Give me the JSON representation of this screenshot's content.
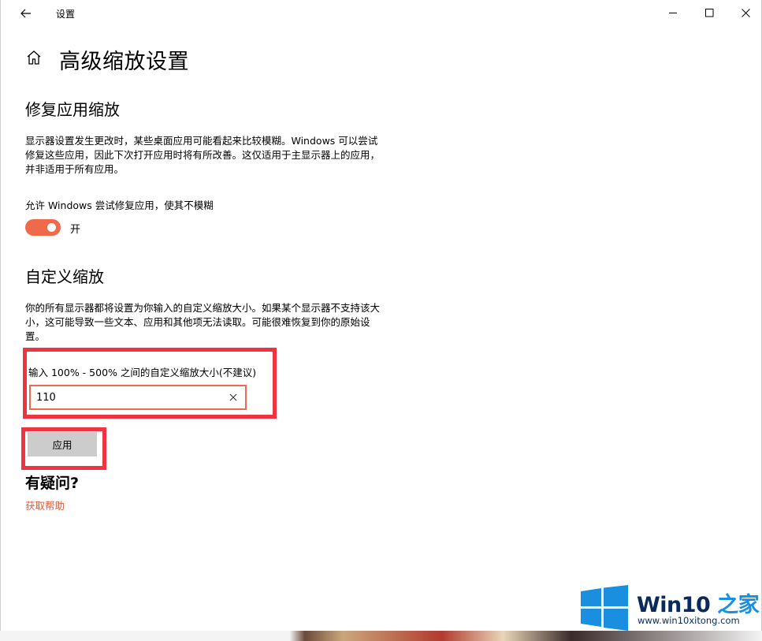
{
  "window": {
    "title": "设置"
  },
  "page": {
    "title": "高级缩放设置"
  },
  "fix_apps": {
    "title": "修复应用缩放",
    "description": "显示器设置发生更改时，某些桌面应用可能看起来比较模糊。Windows 可以尝试修复这些应用，因此下次打开应用时将有所改善。这仅适用于主显示器上的应用，并非适用于所有应用。",
    "toggle_label": "允许 Windows 尝试修复应用，使其不模糊",
    "toggle_state": "开",
    "toggle_on": true,
    "accent_color": "#ee6a4a"
  },
  "custom_scaling": {
    "title": "自定义缩放",
    "description": "你的所有显示器都将设置为你输入的自定义缩放大小。如果某个显示器不支持该大小，这可能导致一些文本、应用和其他项无法读取。可能很难恢复到你的原始设置。",
    "input_label": "输入 100% - 500% 之间的自定义缩放大小(不建议)",
    "input_value": "110",
    "apply_label": "应用"
  },
  "help": {
    "title": "有疑问?",
    "link": "获取帮助"
  },
  "watermark": {
    "brand_main": "Win10",
    "brand_accent": " 之家",
    "url": "www.win10xitong.com"
  },
  "icons": {
    "back": "back-arrow-icon",
    "home": "home-icon",
    "minimize": "minimize-icon",
    "maximize": "maximize-icon",
    "close": "close-icon",
    "clear": "clear-icon"
  },
  "highlight_color": "#ef3340"
}
